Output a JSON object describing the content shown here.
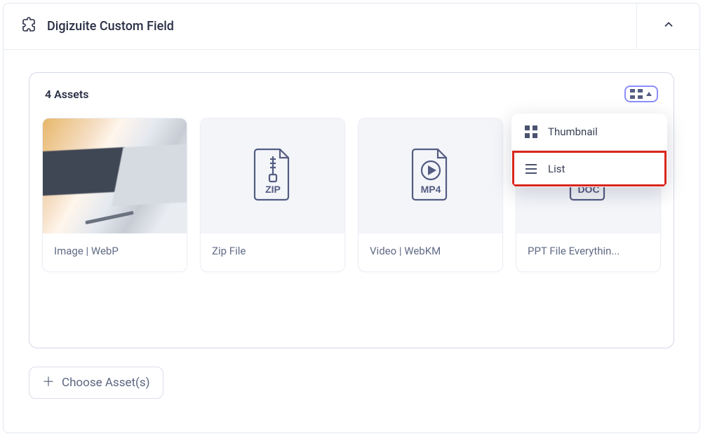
{
  "header": {
    "title": "Digizuite Custom Field"
  },
  "assets": {
    "count_label": "4 Assets",
    "items": [
      {
        "label": "Image | WebP",
        "type": "image"
      },
      {
        "label": "Zip File",
        "type": "zip"
      },
      {
        "label": "Video | WebKM",
        "type": "mp4"
      },
      {
        "label": "PPT File Everythin...",
        "type": "doc"
      }
    ]
  },
  "view_menu": {
    "thumbnail_label": "Thumbnail",
    "list_label": "List"
  },
  "actions": {
    "choose_assets_label": "Choose Asset(s)"
  },
  "file_badges": {
    "zip": "ZIP",
    "mp4": "MP4",
    "doc": "DOC"
  }
}
